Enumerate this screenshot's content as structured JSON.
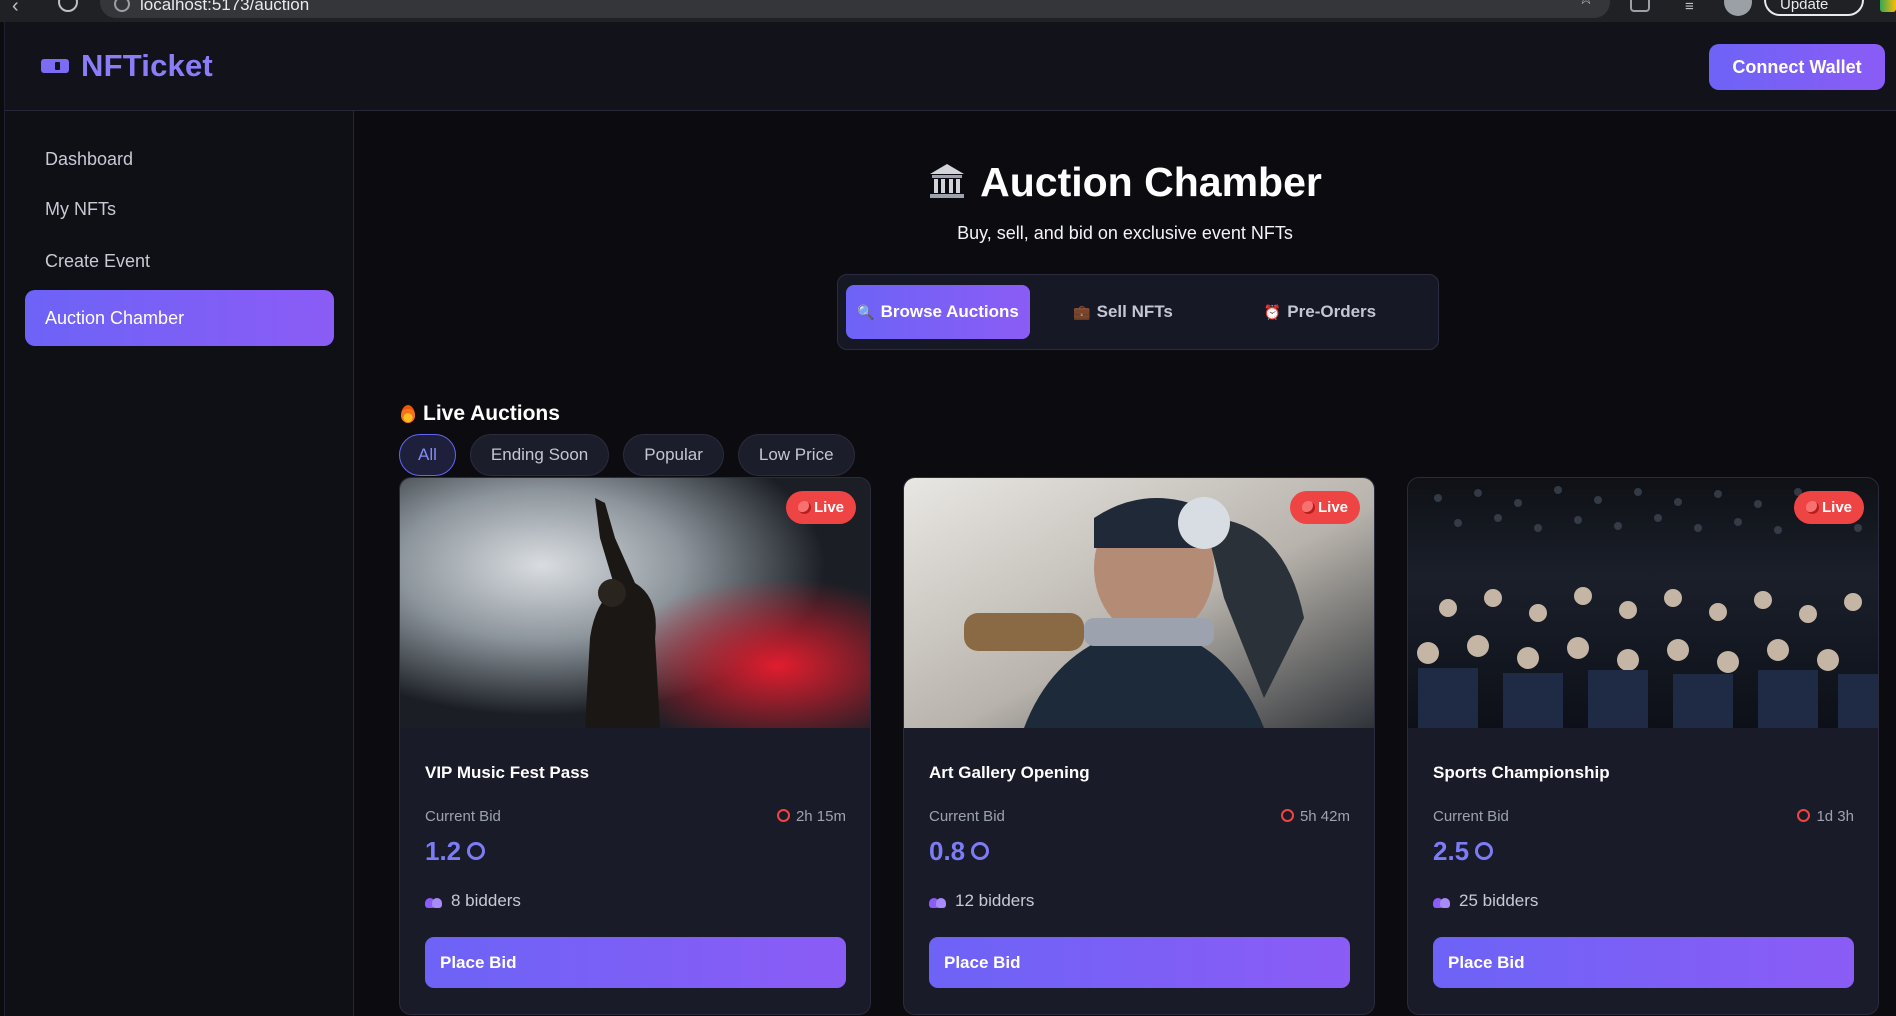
{
  "browser": {
    "url": "localhost:5173/auction",
    "update_label": "Update"
  },
  "header": {
    "logo_text": "NFTicket",
    "connect_label": "Connect Wallet"
  },
  "sidebar": {
    "items": [
      {
        "label": "Dashboard",
        "active": false
      },
      {
        "label": "My NFTs",
        "active": false
      },
      {
        "label": "Create Event",
        "active": false
      },
      {
        "label": "Auction Chamber",
        "active": true
      }
    ]
  },
  "page": {
    "title": "Auction Chamber",
    "subtitle": "Buy, sell, and bid on exclusive event NFTs"
  },
  "tabs": [
    {
      "label": "Browse Auctions",
      "icon": "magnifier-icon",
      "active": true
    },
    {
      "label": "Sell NFTs",
      "icon": "briefcase-icon",
      "active": false
    },
    {
      "label": "Pre-Orders",
      "icon": "alarm-clock-icon",
      "active": false
    }
  ],
  "section": {
    "title": "Live Auctions"
  },
  "filters": [
    {
      "label": "All",
      "active": true
    },
    {
      "label": "Ending Soon",
      "active": false
    },
    {
      "label": "Popular",
      "active": false
    },
    {
      "label": "Low Price",
      "active": false
    }
  ],
  "auctions": [
    {
      "badge": "Live",
      "name": "VIP Music Fest Pass",
      "bid_label": "Current Bid",
      "time_left": "2h 15m",
      "price": "1.2",
      "bidders": "8 bidders",
      "button": "Place Bid"
    },
    {
      "badge": "Live",
      "name": "Art Gallery Opening",
      "bid_label": "Current Bid",
      "time_left": "5h 42m",
      "price": "0.8",
      "bidders": "12 bidders",
      "button": "Place Bid"
    },
    {
      "badge": "Live",
      "name": "Sports Championship",
      "bid_label": "Current Bid",
      "time_left": "1d 3h",
      "price": "2.5",
      "bidders": "25 bidders",
      "button": "Place Bid"
    }
  ],
  "colors": {
    "accent": "#6d63f6",
    "accent_end": "#8b5cf6",
    "live": "#ef4444",
    "background": "#0b0b10",
    "card": "#1a1b28"
  }
}
